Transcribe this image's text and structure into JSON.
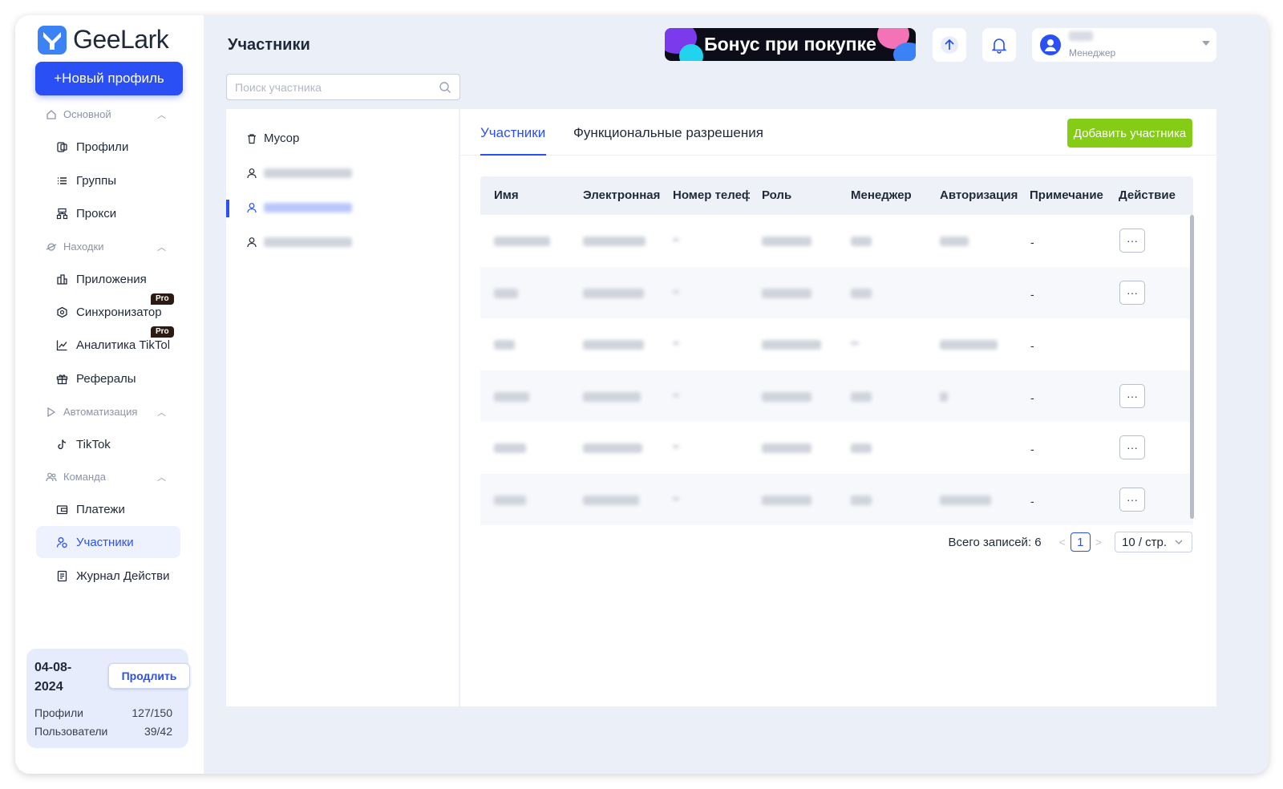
{
  "app": {
    "brand": "GeeLark"
  },
  "sidebar": {
    "new_profile": "+Новый профиль",
    "sections": [
      {
        "label": "Основной",
        "items": [
          {
            "label": "Профили",
            "icon": "profiles-icon"
          },
          {
            "label": "Группы",
            "icon": "list-icon"
          },
          {
            "label": "Прокси",
            "icon": "proxy-icon"
          }
        ]
      },
      {
        "label": "Находки",
        "items": [
          {
            "label": "Приложения",
            "icon": "apps-icon"
          },
          {
            "label": "Синхронизатор",
            "icon": "sync-icon",
            "badge": "Pro"
          },
          {
            "label": "Аналитика TikTok",
            "icon": "chart-icon",
            "badge": "Pro"
          },
          {
            "label": "Рефералы",
            "icon": "gift-icon"
          }
        ]
      },
      {
        "label": "Автоматизация",
        "items": [
          {
            "label": "TikTok",
            "icon": "tiktok-icon"
          }
        ]
      },
      {
        "label": "Команда",
        "items": [
          {
            "label": "Платежи",
            "icon": "wallet-icon"
          },
          {
            "label": "Участники",
            "icon": "members-icon",
            "active": true
          },
          {
            "label": "Журнал Действий",
            "icon": "log-icon"
          }
        ]
      }
    ],
    "plan": {
      "date": "04-08-2024",
      "renew": "Продлить",
      "profiles_label": "Профили",
      "profiles_value": "127/150",
      "users_label": "Пользователи",
      "users_value": "39/42"
    }
  },
  "header": {
    "title": "Участники",
    "banner": "Бонус при покупке",
    "user_role": "Менеджер"
  },
  "search": {
    "placeholder": "Поиск участника"
  },
  "tree": {
    "trash": "Мусор"
  },
  "tabs": [
    {
      "label": "Участники",
      "active": true
    },
    {
      "label": "Функциональные разрешения"
    }
  ],
  "add_member": "Добавить участника",
  "table": {
    "columns": [
      "Имя",
      "Электронная",
      "Номер телеф",
      "Роль",
      "Менеджер",
      "Авторизация",
      "Примечание",
      "Действие"
    ],
    "rows": [
      {
        "note": "-",
        "action": "···"
      },
      {
        "note": "-",
        "action": "···"
      },
      {
        "note": "-",
        "action": ""
      },
      {
        "note": "-",
        "action": "···"
      },
      {
        "note": "-",
        "action": "···"
      },
      {
        "note": "-",
        "action": "···"
      }
    ]
  },
  "pagination": {
    "total": "Всего записей: 6",
    "page": "1",
    "size": "10 / стр."
  },
  "colors": {
    "accent": "#2a4ff5",
    "add_button": "#84cc16",
    "background": "#ebeff8"
  }
}
